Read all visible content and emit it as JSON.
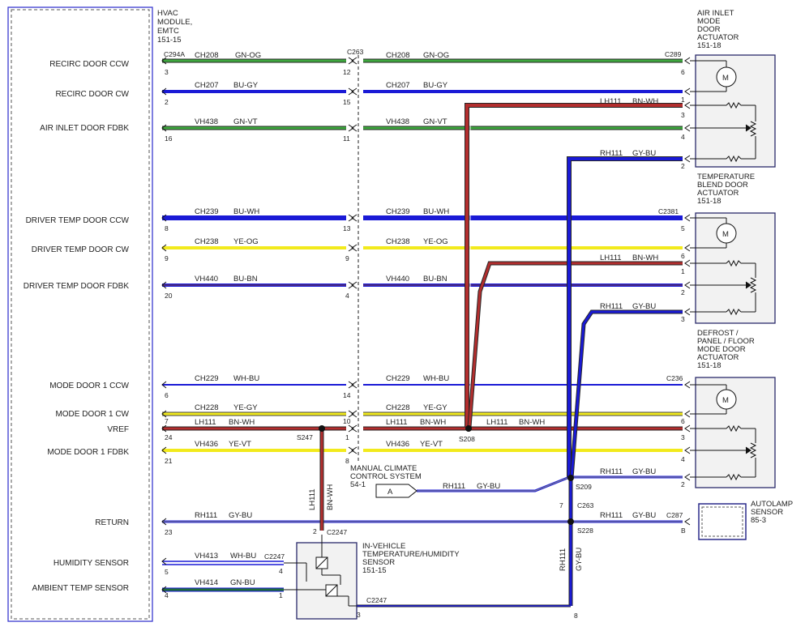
{
  "hvac_module": {
    "title": [
      "HVAC",
      "MODULE,",
      "EMTC",
      "151-15"
    ]
  },
  "left_labels": [
    "RECIRC DOOR CCW",
    "RECIRC DOOR CW",
    "AIR INLET DOOR FDBK",
    "DRIVER TEMP DOOR CCW",
    "DRIVER TEMP DOOR CW",
    "DRIVER TEMP DOOR FDBK",
    "MODE DOOR 1 CCW",
    "MODE DOOR 1 CW",
    "VREF",
    "MODE DOOR 1 FDBK",
    "RETURN",
    "HUMIDITY SENSOR",
    "AMBIENT TEMP SENSOR"
  ],
  "module_pins": [
    "3",
    "2",
    "16",
    "8",
    "9",
    "20",
    "6",
    "7",
    "24",
    "21",
    "23",
    "5",
    "4"
  ],
  "inline_pins": [
    "12",
    "15",
    "11",
    "13",
    "9",
    "4",
    "14",
    "10",
    "1",
    "8"
  ],
  "connectors": {
    "c294a": "C294A",
    "c263": "C263",
    "c263_b": "C263",
    "c289": "C289",
    "c2381": "C2381",
    "c236": "C236",
    "c287": "C287",
    "c2247_a": "C2247",
    "c2247_b": "C2247",
    "c2247_c": "C2247"
  },
  "wires": {
    "ch208": {
      "circuit": "CH208",
      "color": "GN-OG"
    },
    "ch207": {
      "circuit": "CH207",
      "color": "BU-GY"
    },
    "vh438": {
      "circuit": "VH438",
      "color": "GN-VT"
    },
    "ch239": {
      "circuit": "CH239",
      "color": "BU-WH"
    },
    "ch238": {
      "circuit": "CH238",
      "color": "YE-OG"
    },
    "vh440": {
      "circuit": "VH440",
      "color": "BU-BN"
    },
    "ch229": {
      "circuit": "CH229",
      "color": "WH-BU"
    },
    "ch228": {
      "circuit": "CH228",
      "color": "YE-GY"
    },
    "lh111": {
      "circuit": "LH111",
      "color": "BN-WH"
    },
    "vh436": {
      "circuit": "VH436",
      "color": "YE-VT"
    },
    "rh111": {
      "circuit": "RH111",
      "color": "GY-BU"
    },
    "vh413": {
      "circuit": "VH413",
      "color": "WH-BU"
    },
    "vh414": {
      "circuit": "VH414",
      "color": "GN-BU"
    }
  },
  "splices": {
    "s247": "S247",
    "s208": "S208",
    "s209": "S209",
    "s228": "S228"
  },
  "components": {
    "air_inlet": [
      "AIR INLET",
      "MODE",
      "DOOR",
      "ACTUATOR",
      "151-18"
    ],
    "temp_blend": [
      "TEMPERATURE",
      "BLEND DOOR",
      "ACTUATOR",
      "151-18"
    ],
    "defrost": [
      "DEFROST /",
      "PANEL / FLOOR",
      "MODE DOOR",
      "ACTUATOR",
      "151-18"
    ],
    "autolamp": [
      "AUTOLAMP",
      "SENSOR",
      "85-3"
    ],
    "in_vehicle": [
      "IN-VEHICLE",
      "TEMPERATURE/HUMIDITY",
      "SENSOR",
      "151-15"
    ],
    "manual_cc": [
      "MANUAL CLIMATE",
      "CONTROL SYSTEM",
      "54-1"
    ],
    "ref_a": "A"
  },
  "actuator_pins": {
    "air_inlet": [
      "6",
      "1",
      "3",
      "4",
      "2"
    ],
    "temp_blend": [
      "5",
      "6",
      "1",
      "2",
      "3"
    ],
    "defrost": [
      "6",
      "3",
      "4",
      "2"
    ],
    "autolamp": "B",
    "c263_pins": [
      "7",
      "8"
    ],
    "sensor_pins": [
      "4",
      "1",
      "2",
      "3"
    ]
  },
  "colors": {
    "green": "#3ea83e",
    "blue": "#1a1ad6",
    "yellow": "#f2ea1c",
    "brown": "#b32e2e",
    "module_border": "#3a3ad0"
  }
}
